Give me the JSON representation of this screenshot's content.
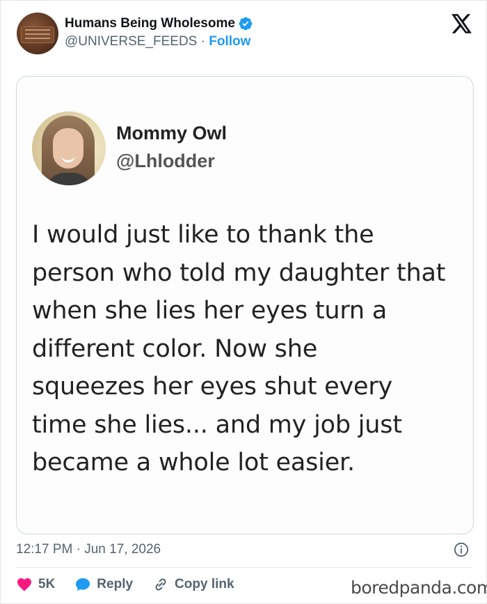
{
  "header": {
    "account_name": "Humans Being Wholesome",
    "handle": "@UNIVERSE_FEEDS",
    "separator": "·",
    "follow_label": "Follow"
  },
  "embedded_tweet": {
    "author_name": "Mommy Owl",
    "author_handle": "@Lhlodder",
    "text": "I would just like to thank the\nperson who told my daughter that\nwhen she lies her eyes turn a\ndifferent color. Now she\nsqueezes her eyes shut every\ntime she lies... and my job just\nbecame a whole lot easier."
  },
  "footer": {
    "timestamp": "12:17 PM · Jun 17, 2026",
    "like_count": "5K",
    "reply_label": "Reply",
    "copy_link_label": "Copy link"
  },
  "watermark": "boredpanda.com",
  "colors": {
    "accent": "#1d9bf0",
    "like": "#f91880",
    "text_primary": "#0f1419",
    "text_secondary": "#536471"
  },
  "icons": [
    "x-logo-icon",
    "verified-badge-icon",
    "info-icon",
    "heart-icon",
    "reply-bubble-icon",
    "link-icon"
  ]
}
